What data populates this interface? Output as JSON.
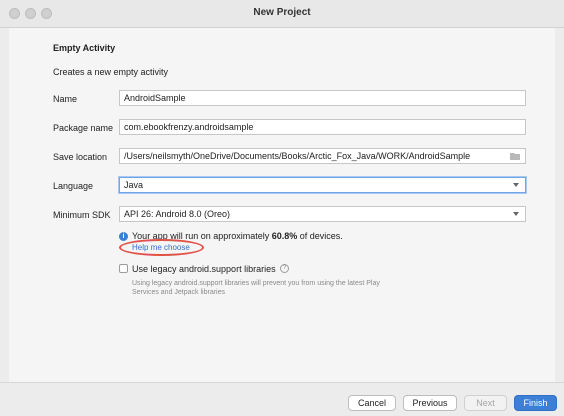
{
  "window": {
    "title": "New Project"
  },
  "activity": {
    "heading": "Empty Activity",
    "description": "Creates a new empty activity"
  },
  "form": {
    "name": {
      "label": "Name",
      "value": "AndroidSample"
    },
    "package": {
      "label": "Package name",
      "value": "com.ebookfrenzy.androidsample"
    },
    "save_location": {
      "label": "Save location",
      "value": "/Users/neilsmyth/OneDrive/Documents/Books/Arctic_Fox_Java/WORK/AndroidSample"
    },
    "language": {
      "label": "Language",
      "value": "Java"
    },
    "min_sdk": {
      "label": "Minimum SDK",
      "value": "API 26: Android 8.0 (Oreo)"
    }
  },
  "sdk_info": {
    "prefix": "Your app will run on approximately ",
    "percent": "60.8%",
    "suffix": " of devices.",
    "help_link": "Help me choose"
  },
  "legacy": {
    "label": "Use legacy android.support libraries",
    "hint": "Using legacy android.support libraries will prevent you from using the latest Play Services and Jetpack libraries"
  },
  "buttons": {
    "cancel": "Cancel",
    "previous": "Previous",
    "next": "Next",
    "finish": "Finish"
  },
  "colors": {
    "accent": "#3b7fd6",
    "highlight": "#e2524a"
  },
  "icons": {
    "folder": "folder-icon",
    "dropdown": "chevron-down-icon",
    "info": "info-icon",
    "help": "question-icon"
  }
}
